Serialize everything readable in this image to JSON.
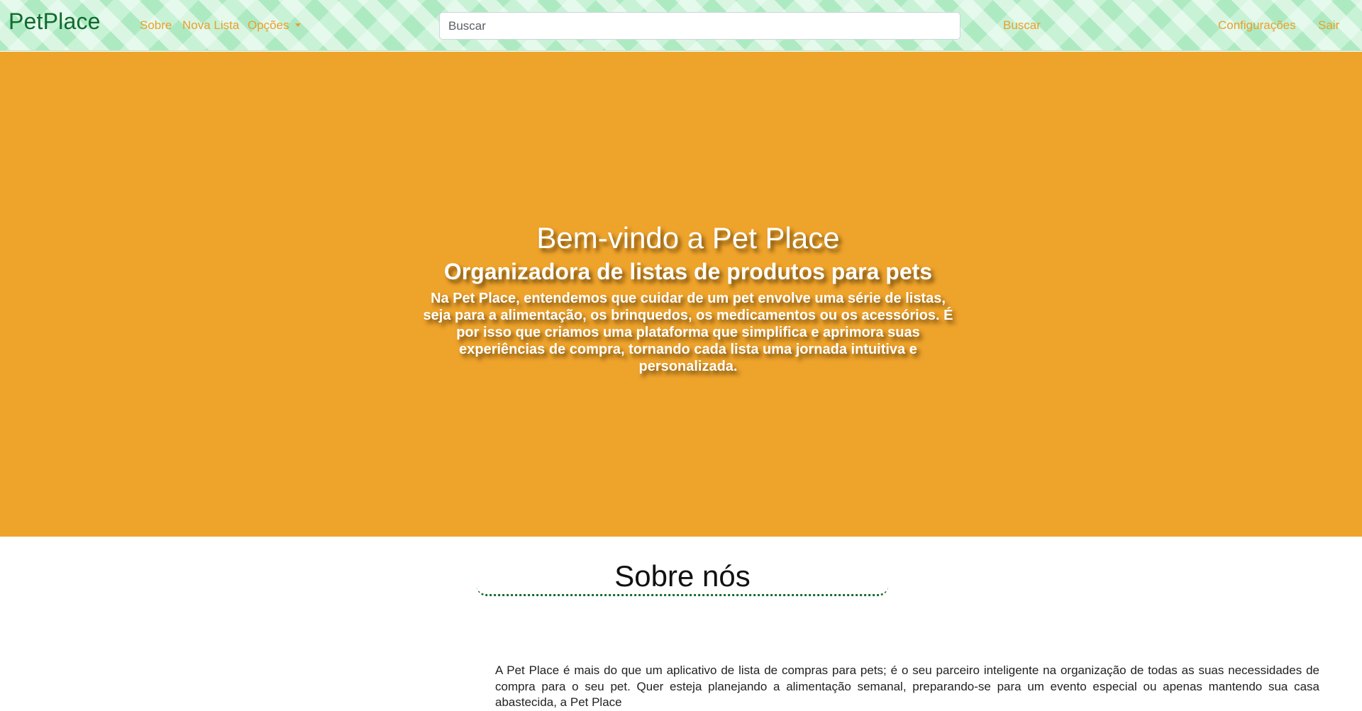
{
  "navbar": {
    "brand": "PetPlace",
    "links": {
      "about": "Sobre",
      "new_list": "Nova Lista",
      "options": "Opções"
    },
    "search": {
      "placeholder": "Buscar",
      "button_label": "Buscar"
    },
    "settings": "Configurações",
    "logout": "Sair"
  },
  "hero": {
    "title": "Bem-vindo a Pet Place",
    "subtitle": "Organizadora de listas de produtos para pets",
    "text": "Na Pet Place, entendemos que cuidar de um pet envolve uma série de listas, seja para a alimentação, os brinquedos, os medicamentos ou os acessórios. É por isso que criamos uma plataforma que simplifica e aprimora suas experiências de compra, tornando cada lista uma jornada intuitiva e personalizada."
  },
  "about": {
    "heading": "Sobre nós",
    "text": "A Pet Place é mais do que um aplicativo de lista de compras para pets; é o seu parceiro inteligente na organização de todas as suas necessidades de compra para o seu pet. Quer esteja planejando a alimentação semanal, preparando-se para um evento especial ou apenas mantendo sua casa abastecida, a Pet Place"
  },
  "colors": {
    "brand": "#0f6b2e",
    "accent": "#e8a02b",
    "hero_background": "#eea32b",
    "navbar_background": "#c8f2d6"
  }
}
